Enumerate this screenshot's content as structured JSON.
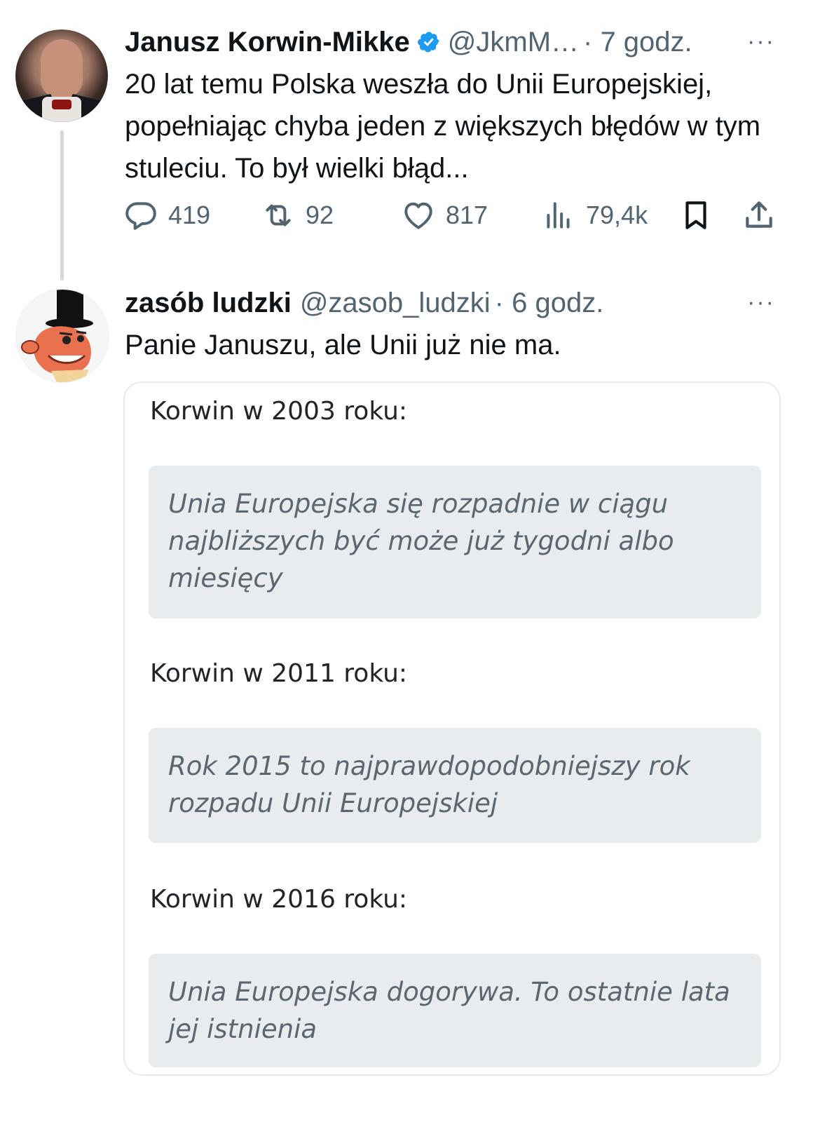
{
  "tweet": {
    "author_name": "Janusz Korwin-Mikke",
    "verified_icon": "verified-badge-icon",
    "handle": "@JkmM…",
    "time": "· 7 godz.",
    "more": "···",
    "text": "20 lat temu Polska weszła do Unii Europejskiej, popełniając chyba jeden z większych błędów w tym stuleciu. To był wielki błąd...",
    "actions": {
      "replies": "419",
      "retweets": "92",
      "likes": "817",
      "views": "79,4k"
    }
  },
  "reply": {
    "author_name": "zasób ludzki",
    "handle": "@zasob_ludzki",
    "time": "· 6 godz.",
    "more": "···",
    "text": "Panie Januszu, ale Unii już nie ma.",
    "quotes": [
      {
        "label": "Korwin w 2003 roku:",
        "quote": "Unia Europejska się rozpadnie w ciągu najbliższych być może już tygodni albo miesięcy"
      },
      {
        "label": "Korwin w 2011 roku:",
        "quote": "Rok 2015 to najprawdopodobniejszy rok rozpadu Unii Europejskiej"
      },
      {
        "label": "Korwin w 2016 roku:",
        "quote": "Unia Europejska dogorywa. To ostatnie lata jej istnienia"
      }
    ]
  },
  "colors": {
    "accent": "#1d9bf0",
    "muted": "#536471",
    "quote_bg": "#e9ecef"
  }
}
